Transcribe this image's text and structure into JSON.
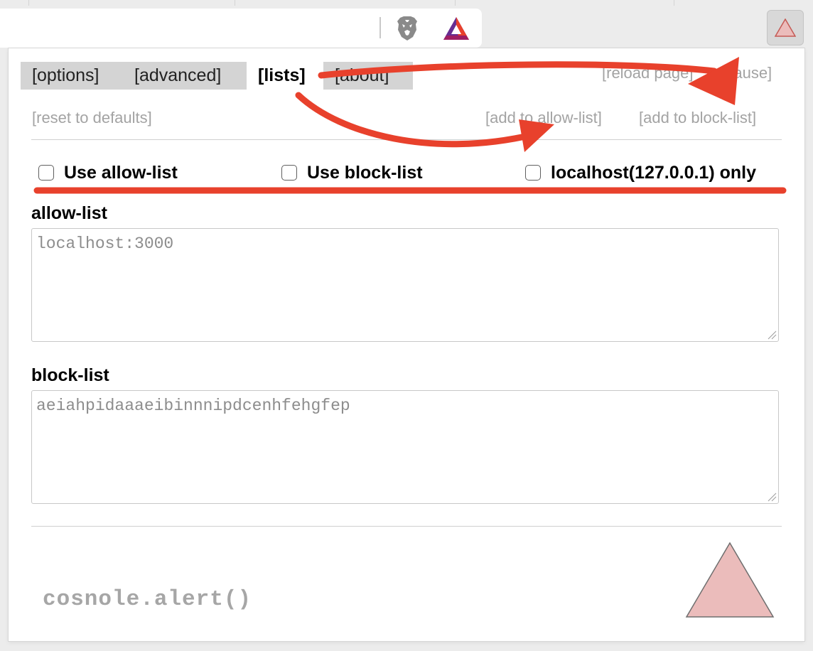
{
  "browser": {
    "toolbar_icons": [
      "brave-lion-icon",
      "bat-triangle-icon"
    ],
    "extension_icon": "triangle-icon"
  },
  "popup": {
    "tabs": [
      {
        "label": "[options]",
        "active": false
      },
      {
        "label": "[advanced]",
        "active": false
      },
      {
        "label": "[lists]",
        "active": true
      },
      {
        "label": "[about]",
        "active": false
      }
    ],
    "header_links": {
      "reload": "[reload page]",
      "pause": "[pause]"
    },
    "actions": {
      "reset": "[reset to defaults]",
      "add_allow": "[add to allow-list]",
      "add_block": "[add to block-list]"
    },
    "checkboxes": [
      {
        "label": "Use allow-list",
        "checked": false
      },
      {
        "label": "Use block-list",
        "checked": false
      },
      {
        "label": "localhost(127.0.0.1) only",
        "checked": false
      }
    ],
    "allow_list": {
      "title": "allow-list",
      "placeholder": "localhost:3000"
    },
    "block_list": {
      "title": "block-list",
      "placeholder": "aeiahpidaaaeibinnnipdcenhfehgfep"
    },
    "footer": {
      "console_text": "cosnole.alert()",
      "logo_icon": "triangle-logo-icon"
    }
  },
  "colors": {
    "annotation_red": "#e8412c",
    "triangle_fill": "#ebbcbb",
    "inactive_tab": "#d4d4d4",
    "muted_link": "#a3a3a3"
  }
}
